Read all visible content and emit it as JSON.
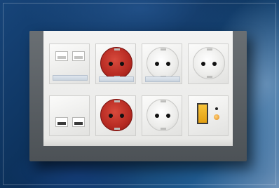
{
  "scene": {
    "subject": "wall-outlet-panel",
    "colors": {
      "background": "#0e3560",
      "frame": "#555b60",
      "panel": "#f3f3f2",
      "red_socket": "#b62a22",
      "switch": "#f7c43a"
    },
    "modules": [
      {
        "type": "data-outlet",
        "color": "white",
        "row": 1,
        "col": 1
      },
      {
        "type": "schuko-socket",
        "color": "red",
        "row": 1,
        "col": 2
      },
      {
        "type": "schuko-socket",
        "color": "white",
        "row": 1,
        "col": 3
      },
      {
        "type": "schuko-socket",
        "color": "white",
        "row": 1,
        "col": 4
      },
      {
        "type": "data-outlet",
        "color": "white",
        "row": 2,
        "col": 1
      },
      {
        "type": "schuko-socket",
        "color": "red",
        "row": 2,
        "col": 2
      },
      {
        "type": "schuko-socket",
        "color": "white",
        "row": 2,
        "col": 3
      },
      {
        "type": "switch-with-indicator",
        "color": "yellow",
        "row": 2,
        "col": 4
      }
    ]
  }
}
